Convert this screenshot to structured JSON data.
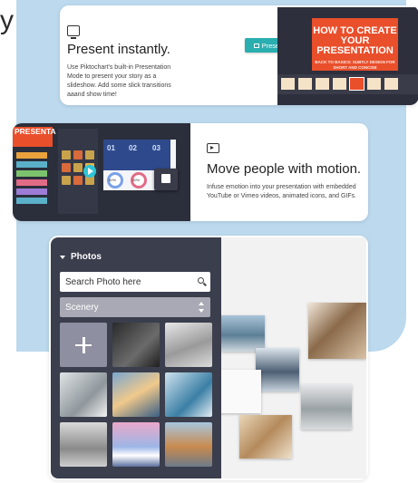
{
  "cards": {
    "present": {
      "title": "Present instantly.",
      "body": "Use Piktochart's built-in Presentation Mode to present your story as a slideshow. Add some slick transitions aaand show time!",
      "button_label": "Present",
      "slide_title": "HOW TO CREATE YOUR PRESENTATION",
      "slide_subtitle": "BACK TO BASICS: SUBTLY DESIGN FOR SHORT AND CONCISE"
    },
    "motion": {
      "title": "Move people with motion.",
      "body": "Infuse emotion into your presentation with embedded YouTube or Vimeo videos, animated icons, and GIFs.",
      "slide_title": "PRESENTA",
      "numbers": [
        "01",
        "02",
        "03"
      ],
      "percents": [
        "60%",
        "30%",
        "50"
      ]
    },
    "photos": {
      "panel_title": "Photos",
      "search_placeholder": "Search Photo here",
      "category_value": "Scenery"
    }
  },
  "colors": {
    "accent_blue": "#bcd9ee",
    "present_button": "#2aaeb0",
    "slide_orange": "#e94f2b",
    "panel_dark": "#3b3e4d"
  }
}
